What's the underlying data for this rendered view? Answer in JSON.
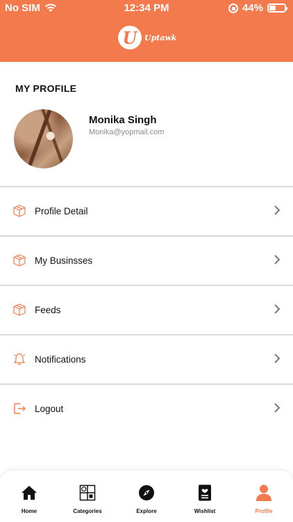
{
  "status_bar": {
    "carrier": "No SIM",
    "time": "12:34 PM",
    "battery": "44%",
    "battery_level": 0.44
  },
  "header": {
    "logo_letter": "U",
    "logo_text": "Uptawk",
    "brand_color": "#f27a4c"
  },
  "profile": {
    "section_title": "MY PROFILE",
    "name": "Monika Singh",
    "email": "Monika@yopmail.com"
  },
  "menu": {
    "items": [
      {
        "label": "Profile Detail",
        "icon": "box-icon"
      },
      {
        "label": "My Businsses",
        "icon": "box-icon"
      },
      {
        "label": "Feeds",
        "icon": "box-icon"
      },
      {
        "label": "Notifications",
        "icon": "bell-icon"
      },
      {
        "label": "Logout",
        "icon": "logout-icon"
      }
    ]
  },
  "tabbar": {
    "items": [
      {
        "label": "Home",
        "icon": "home-icon"
      },
      {
        "label": "Categories",
        "icon": "categories-icon"
      },
      {
        "label": "Explore",
        "icon": "compass-icon"
      },
      {
        "label": "Wishlist",
        "icon": "wishlist-icon"
      },
      {
        "label": "Profile",
        "icon": "profile-icon",
        "active": true
      }
    ]
  }
}
